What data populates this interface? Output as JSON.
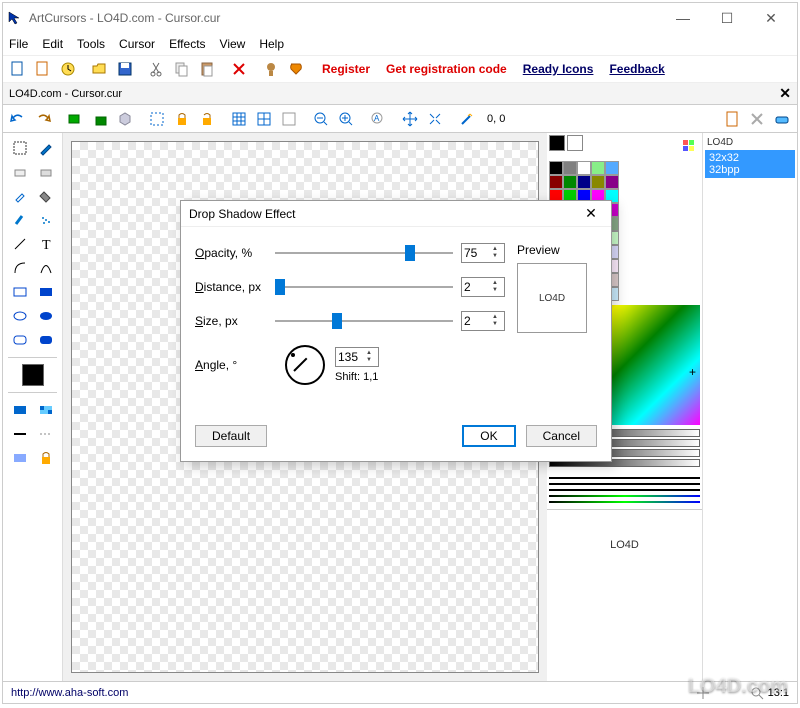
{
  "window": {
    "title": "ArtCursors - LO4D.com - Cursor.cur",
    "min_icon": "—",
    "max_icon": "☐",
    "close_icon": "✕"
  },
  "menu": {
    "items": [
      "File",
      "Edit",
      "Tools",
      "Cursor",
      "Effects",
      "View",
      "Help"
    ]
  },
  "links": {
    "register": "Register",
    "getcode": "Get registration code",
    "readyicons": "Ready Icons",
    "feedback": "Feedback"
  },
  "doctab": {
    "name": "LO4D.com - Cursor.cur",
    "close": "✕"
  },
  "coords": "0, 0",
  "format_list": {
    "thumb": "LO4D",
    "line1": "32x32",
    "line2": "32bpp"
  },
  "bottom_preview": "LO4D",
  "statusbar": {
    "url": "http://www.aha-soft.com",
    "ratio": "13:1"
  },
  "watermark": "LO4D.com",
  "modal": {
    "title": "Drop Shadow Effect",
    "close": "✕",
    "opacity_label": "Opacity, %",
    "opacity_val": "75",
    "distance_label": "Distance, px",
    "distance_val": "2",
    "size_label": "Size, px",
    "size_val": "2",
    "angle_label": "Angle, °",
    "angle_val": "135",
    "shift_text": "Shift: 1,1",
    "preview_label": "Preview",
    "preview_text": "LO4D",
    "default_btn": "Default",
    "ok_btn": "OK",
    "cancel_btn": "Cancel"
  },
  "palette_rows": [
    [
      "#000",
      "#808080",
      "#fff",
      "#8e8",
      "#5af"
    ],
    [
      "#800",
      "#080",
      "#008",
      "#880",
      "#808"
    ],
    [
      "#f00",
      "#0c0",
      "#00f",
      "#f0f",
      "#0ff"
    ],
    [
      "#f80",
      "#8f0",
      "#08f",
      "#f08",
      "#c0c"
    ],
    [
      "#fa0",
      "#af0",
      "#0af",
      "#fa8",
      "#8a8"
    ],
    [
      "#fc8",
      "#cf8",
      "#8cf",
      "#fcf",
      "#cfc"
    ],
    [
      "#fdb",
      "#dfd",
      "#bdf",
      "#fdf",
      "#ddf"
    ],
    [
      "#fee",
      "#efe",
      "#eef",
      "#eff",
      "#fef"
    ],
    [
      "#cff",
      "#dff",
      "#cdd",
      "#ddc",
      "#dcc"
    ],
    [
      "#8ff",
      "#9ff",
      "#aef",
      "#bef",
      "#cef"
    ]
  ]
}
